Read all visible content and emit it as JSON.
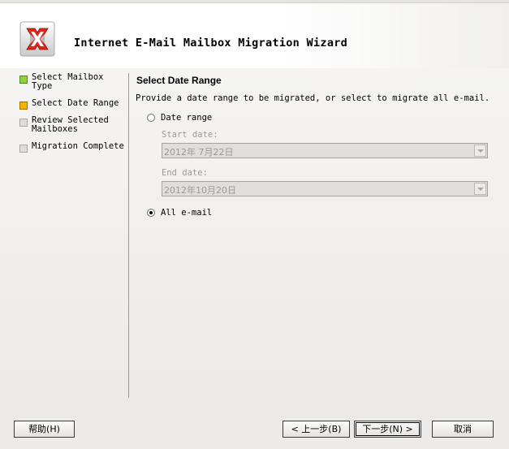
{
  "window": {
    "title": "Internet E-Mail Mailbox Migration Wizard",
    "logo_icon": "exchange-logo-icon",
    "accent_color": "#e2251b"
  },
  "sidebar": {
    "items": [
      {
        "label": "Select Mailbox Type",
        "state": "complete",
        "color": "#8cd43a"
      },
      {
        "label": "Select Date Range",
        "state": "current",
        "color": "#f6b400"
      },
      {
        "label": "Review Selected Mailboxes",
        "state": "pending",
        "color": "#dcdcdc"
      },
      {
        "label": "Migration Complete",
        "state": "pending",
        "color": "#dcdcdc"
      }
    ]
  },
  "main": {
    "section_title": "Select Date Range",
    "description": "Provide a date range to be migrated, or select to migrate all e-mail.",
    "date_range_option": {
      "label": "Date range",
      "selected": false
    },
    "start_date": {
      "label": "Start date:",
      "value": "2012年 7月22日",
      "enabled": false
    },
    "end_date": {
      "label": "End date:",
      "value": "2012年10月20日",
      "enabled": false
    },
    "all_email_option": {
      "label": "All e-mail",
      "selected": true
    }
  },
  "footer": {
    "help_label": "帮助(H)",
    "back_label": "< 上一步(B)",
    "next_label": "下一步(N) >",
    "cancel_label": "取消"
  }
}
